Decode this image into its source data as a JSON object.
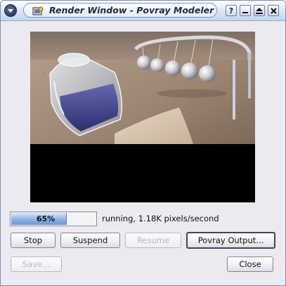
{
  "window": {
    "title": "Render Window - Povray Modeler",
    "title_buttons": {
      "help": "?",
      "minimize": "▁",
      "maximize": "▲",
      "close": "✕"
    }
  },
  "render": {
    "status": "running, 1.18K pixels/second",
    "progress_percent_label": "65%",
    "progress_fraction": 0.65
  },
  "buttons": {
    "stop": "Stop",
    "suspend": "Suspend",
    "resume": "Resume",
    "povray_output": "Povray Output...",
    "save": "Save...",
    "close": "Close"
  },
  "colors": {
    "accent": "#8fb1e3",
    "titlebar": "#c4d4ec"
  },
  "icons": {
    "window_menu": "window-menu-icon",
    "app": "povray-app-icon"
  }
}
